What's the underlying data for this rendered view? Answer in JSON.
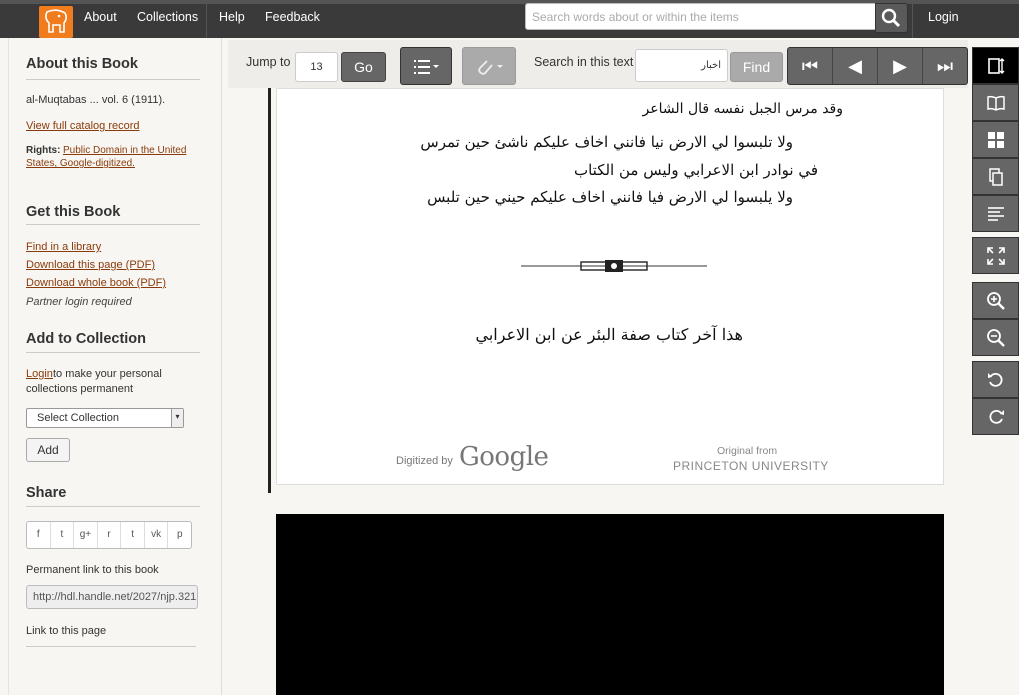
{
  "topnav": {
    "links": [
      "About",
      "Collections",
      "Help",
      "Feedback"
    ],
    "search_placeholder": "Search words about or within the items",
    "login": "Login",
    "icons": {
      "logo": "elephant-logo",
      "search": "search-icon"
    }
  },
  "sidebar": {
    "about_heading": "About this Book",
    "book_title": "al-Muqtabas ... vol. 6 (1911).",
    "catalog_link": "View full catalog record",
    "rights_label": "Rights:",
    "rights_line1": "Public Domain in the United",
    "rights_line2": "States, Google-digitized.",
    "get_heading": "Get this Book",
    "find_library": "Find in a library",
    "download_page": "Download this page (PDF)",
    "download_book": "Download whole book (PDF)",
    "partner_login": "Partner login required",
    "collection_heading": "Add to Collection",
    "login_link": "Login",
    "collection_text1": " to make your personal",
    "collection_text2": "collections permanent",
    "select_collection": "Select Collection",
    "add_button": "Add",
    "share_heading": "Share",
    "share_icons": [
      "f",
      "t",
      "g+",
      "r",
      "t",
      "vk",
      "p"
    ],
    "permanent_label": "Permanent link to this book",
    "permanent_url": "http://hdl.handle.net/2027/njp.321",
    "link_page_label": "Link to this page"
  },
  "toolbar": {
    "jump_label": "Jump to",
    "jump_value": "13",
    "go_label": "Go",
    "search_label": "Search in this text",
    "search_value": "اخبار",
    "find_label": "Find",
    "icons": [
      "list-icon",
      "paperclip-icon",
      "first-page-icon",
      "prev-page-icon",
      "next-page-icon",
      "last-page-icon"
    ]
  },
  "page": {
    "line1": "وقد مرس الجبل نفسه قال الشاعر",
    "line2": "ولا تلبسوا لي الارض نيا فانني      اخاف عليكم ناشئ حين تمرس",
    "line3": "في نوادر ابن الاعرابي وليس من الكتاب",
    "line4": "ولا يلبسوا لي الارض فيا فانني      اخاف عليكم حيني حين تلبس",
    "line5": "هذا آخر كتاب صفة البئر عن ابن الاعرابي",
    "digitized": "Digitized by",
    "google": "Google",
    "original_from": "Original from",
    "princeton": "PRINCETON UNIVERSITY"
  },
  "right_tools": [
    "scroll-view-icon",
    "book-view-icon",
    "thumbnail-view-icon",
    "page-view-icon",
    "text-view-icon",
    "fullscreen-icon",
    "zoom-in-icon",
    "zoom-out-icon",
    "rotate-left-icon",
    "rotate-right-icon"
  ]
}
